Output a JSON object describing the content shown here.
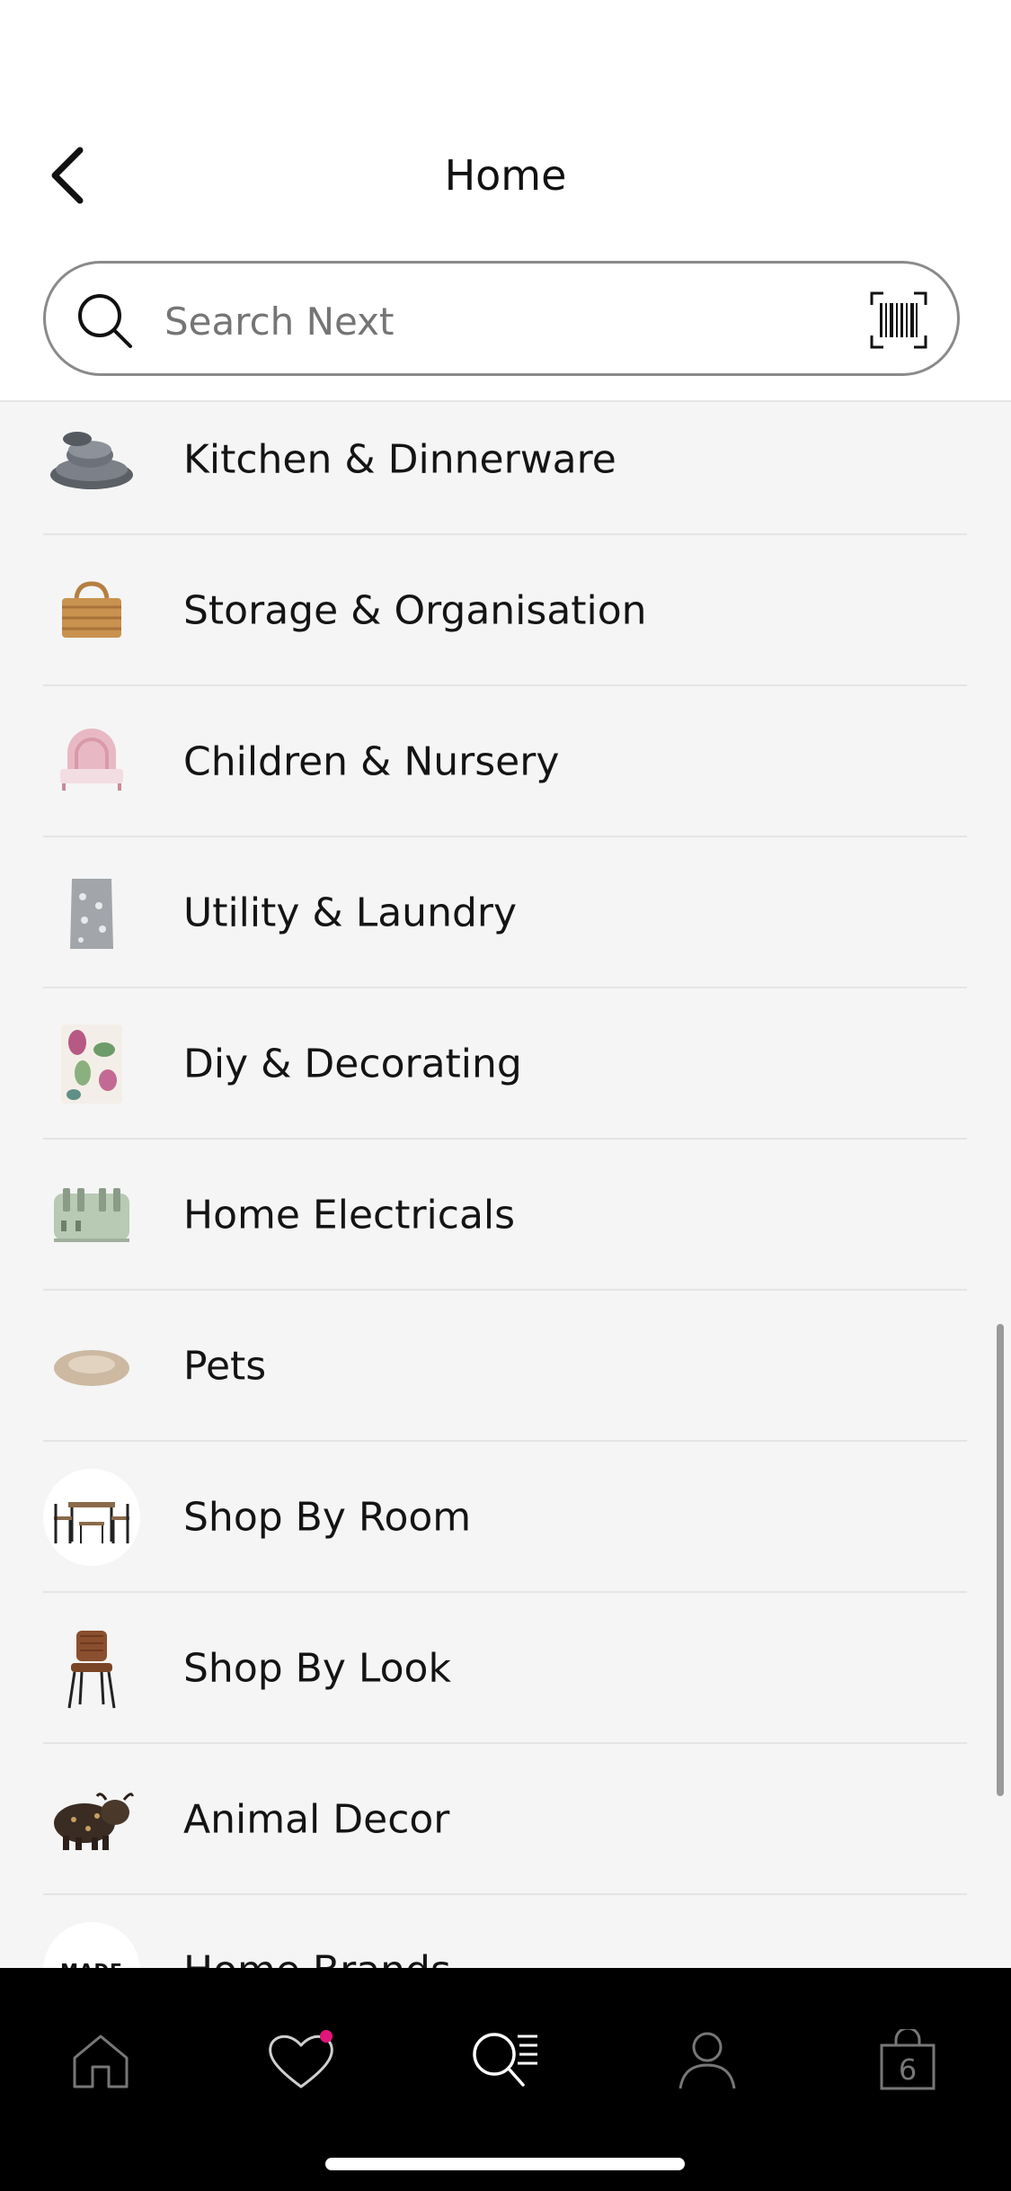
{
  "header": {
    "title": "Home",
    "back_icon": "chevron-left-icon"
  },
  "search": {
    "placeholder": "Search Next",
    "value": "",
    "search_icon": "search-icon",
    "barcode_icon": "barcode-scan-icon"
  },
  "categories": [
    {
      "label": "Kitchen & Dinnerware",
      "icon": "dinnerware-thumbnail"
    },
    {
      "label": "Storage & Organisation",
      "icon": "wicker-basket-thumbnail"
    },
    {
      "label": "Children & Nursery",
      "icon": "kids-bed-thumbnail"
    },
    {
      "label": "Utility & Laundry",
      "icon": "laundry-bag-thumbnail"
    },
    {
      "label": "Diy & Decorating",
      "icon": "floral-wallpaper-thumbnail"
    },
    {
      "label": "Home Electricals",
      "icon": "toaster-thumbnail"
    },
    {
      "label": "Pets",
      "icon": "pet-bed-thumbnail"
    },
    {
      "label": "Shop By Room",
      "icon": "dining-set-thumbnail"
    },
    {
      "label": "Shop By Look",
      "icon": "leather-chair-thumbnail"
    },
    {
      "label": "Animal Decor",
      "icon": "highland-cow-thumbnail"
    },
    {
      "label": "Home Brands",
      "icon": "made-logo-thumbnail",
      "logo_text": "MADE"
    }
  ],
  "tabbar": {
    "tabs": [
      {
        "name": "home-tab",
        "icon": "home-icon"
      },
      {
        "name": "favourites-tab",
        "icon": "heart-icon",
        "badge_color": "#e0167a"
      },
      {
        "name": "search-tab",
        "icon": "search-list-icon",
        "active": true
      },
      {
        "name": "account-tab",
        "icon": "person-icon"
      },
      {
        "name": "bag-tab",
        "icon": "shopping-bag-icon",
        "count": "6"
      }
    ]
  },
  "colors": {
    "header_bg": "#ffffff",
    "list_bg": "#f5f5f5",
    "tabbar_bg": "#000000",
    "accent_badge": "#e0167a"
  }
}
